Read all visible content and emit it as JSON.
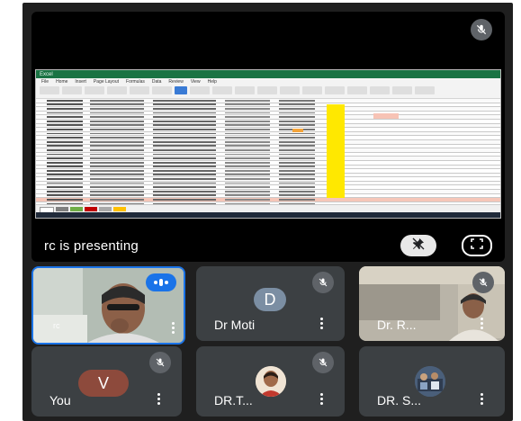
{
  "stage": {
    "presenting_text": "rc is presenting",
    "shared_window": {
      "app": "Excel",
      "tabs": [
        "File",
        "Home",
        "Insert",
        "Page Layout",
        "Formulas",
        "Data",
        "Review",
        "View",
        "Help"
      ]
    }
  },
  "participants": [
    {
      "name": "rc",
      "avatar_letter": "",
      "avatar_color": "",
      "speaking": true
    },
    {
      "name": "Dr Moti",
      "avatar_letter": "D",
      "avatar_color": "#7b8ea3",
      "speaking": false
    },
    {
      "name": "Dr. R...",
      "avatar_letter": "",
      "avatar_color": "",
      "speaking": false
    },
    {
      "name": "You",
      "avatar_letter": "V",
      "avatar_color": "#8d4a3c",
      "speaking": false
    },
    {
      "name": "DR.T...",
      "avatar_letter": "",
      "avatar_color": "",
      "speaking": false
    },
    {
      "name": "DR. S...",
      "avatar_letter": "",
      "avatar_color": "",
      "speaking": false
    }
  ],
  "icons": {
    "mic_off": "mic-off-icon",
    "pin": "unpin-icon",
    "fullscreen": "fullscreen-icon",
    "more": "more-vert-icon",
    "speaking": "speaking-indicator-icon"
  },
  "colors": {
    "background": "#1f1f1f",
    "tile": "#3c4043",
    "active_border": "#1a73e8",
    "excel_green": "#1a7343",
    "highlight_yellow": "#ffe800"
  }
}
